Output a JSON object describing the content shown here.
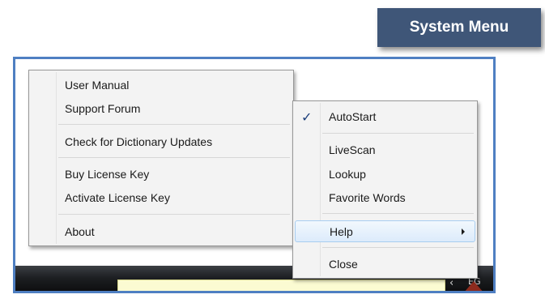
{
  "title": "System Menu",
  "tray": {
    "chevron": "‹",
    "label": "EG"
  },
  "left_menu": {
    "items": [
      "User Manual",
      "Support Forum",
      "Check for Dictionary Updates",
      "Buy License Key",
      "Activate License Key",
      "About"
    ]
  },
  "right_menu": {
    "items": [
      "AutoStart",
      "LiveScan",
      "Lookup",
      "Favorite Words",
      "Help",
      "Close"
    ],
    "checked_item": "AutoStart",
    "highlighted_item": "Help",
    "submenu_item": "Help"
  },
  "colors": {
    "title_badge": "#3f5678",
    "frame_border": "#4f7fc2",
    "taskbar": "#1c1e21",
    "tooltip": "#fbfbd2",
    "pointer_arrow": "#8d2b1e",
    "highlight": "#dcebfb"
  },
  "icons": [
    "checkmark-icon",
    "chevron-right-icon",
    "chevron-left-icon"
  ]
}
